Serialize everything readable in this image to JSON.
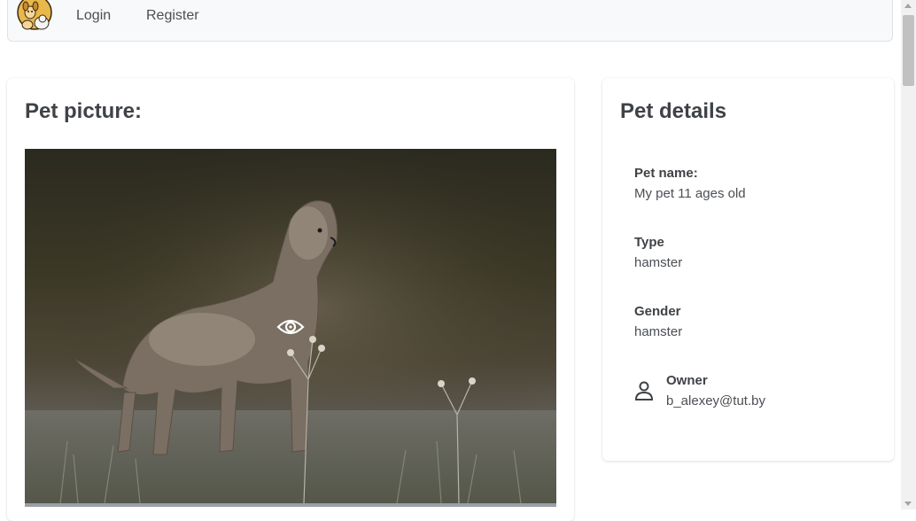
{
  "navbar": {
    "logo_icon": "dog-cat-logo-icon",
    "login_label": "Login",
    "register_label": "Register"
  },
  "picture_card": {
    "title": "Pet picture:",
    "photo_icon": "dog-photo",
    "overlay_icon": "eye-icon"
  },
  "details_card": {
    "title": "Pet details",
    "name_label": "Pet name:",
    "name_value": "My pet 11 ages old",
    "type_label": "Type",
    "type_value": "hamster",
    "gender_label": "Gender",
    "gender_value": "hamster",
    "owner_icon": "person-icon",
    "owner_label": "Owner",
    "owner_value": "b_alexey@tut.by"
  },
  "colors": {
    "navbar_bg": "#f8f9fa",
    "text": "#3f4246"
  }
}
